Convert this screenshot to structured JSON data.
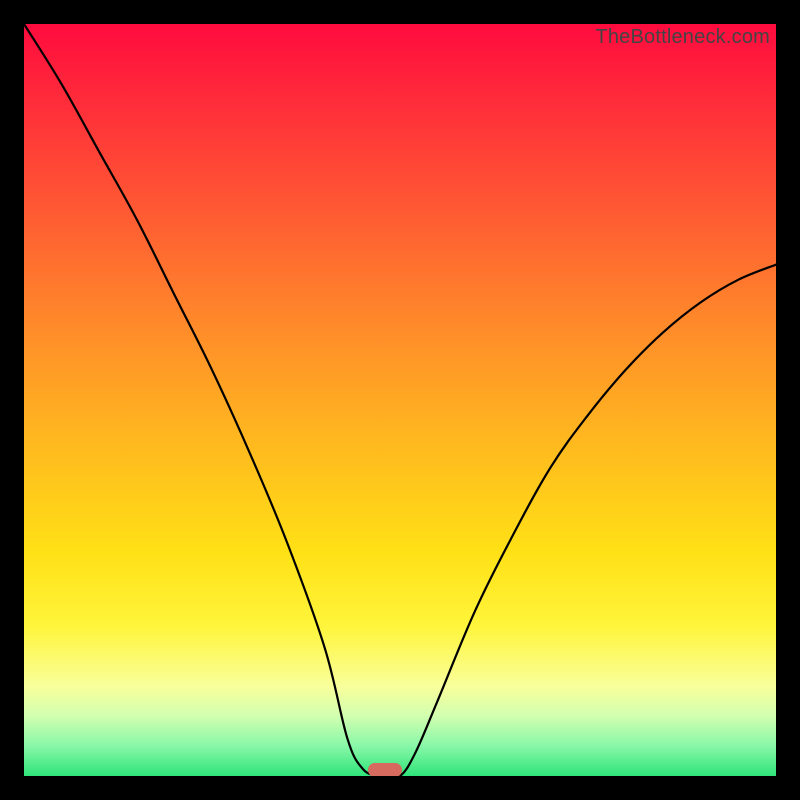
{
  "watermark": "TheBottleneck.com",
  "chart_data": {
    "type": "line",
    "title": "",
    "xlabel": "",
    "ylabel": "",
    "xlim": [
      0,
      100
    ],
    "ylim": [
      0,
      100
    ],
    "grid": false,
    "legend": false,
    "annotations": [],
    "series": [
      {
        "name": "bottleneck-curve",
        "x": [
          0,
          5,
          10,
          15,
          20,
          25,
          30,
          35,
          40,
          43,
          45,
          47,
          48,
          50,
          52,
          55,
          60,
          65,
          70,
          75,
          80,
          85,
          90,
          95,
          100
        ],
        "y": [
          100,
          92,
          83,
          74,
          64,
          54,
          43,
          31,
          17,
          5,
          1,
          0,
          0,
          0,
          3,
          10,
          22,
          32,
          41,
          48,
          54,
          59,
          63,
          66,
          68
        ]
      }
    ],
    "marker": {
      "x": 48,
      "y": 0
    },
    "background_gradient": {
      "top": "#ff0b3e",
      "mid": "#ffe016",
      "bottom": "#2fe47a"
    }
  }
}
